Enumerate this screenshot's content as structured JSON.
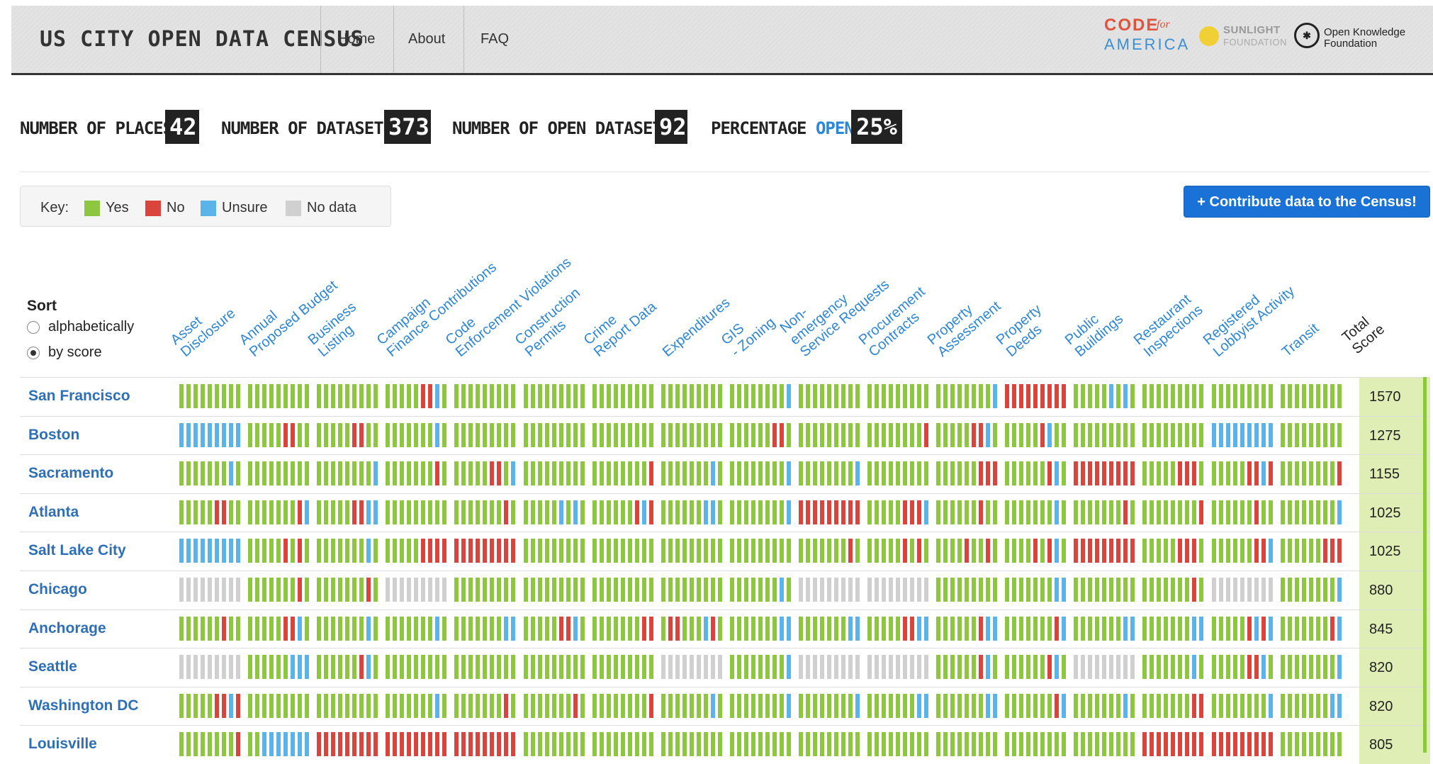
{
  "header": {
    "brand": "US CITY OPEN DATA CENSUS",
    "nav": [
      "Home",
      "About",
      "FAQ"
    ],
    "partners": {
      "cfa_top": "CODE",
      "cfa_for": "for",
      "cfa_bottom": "AMERICA",
      "sunlight_1": "SUNLIGHT",
      "sunlight_2": "FOUNDATION",
      "okf_1": "Open Knowledge",
      "okf_2": "Foundation"
    }
  },
  "stats": {
    "places_label": "NUMBER OF PLACES",
    "places_value": "42",
    "datasets_label": "NUMBER OF DATASETS",
    "datasets_value": "373",
    "open_label": "NUMBER OF OPEN DATASETS",
    "open_value": "92",
    "pct_label": "PERCENTAGE",
    "pct_open_word": "OPEN",
    "pct_value": "25%"
  },
  "key": {
    "label": "Key:",
    "items": [
      {
        "label": "Yes",
        "color": "#8dc63f"
      },
      {
        "label": "No",
        "color": "#d9453d"
      },
      {
        "label": "Unsure",
        "color": "#5ab4ea"
      },
      {
        "label": "No data",
        "color": "#d0d0d0"
      }
    ]
  },
  "cta": "+ Contribute data to the Census!",
  "sort": {
    "title": "Sort",
    "options": [
      {
        "label": "alphabetically",
        "selected": false
      },
      {
        "label": "by score",
        "selected": true
      }
    ]
  },
  "columns": [
    [
      "Asset",
      "Disclosure"
    ],
    [
      "Annual",
      "Proposed Budget"
    ],
    [
      "Business",
      "Listing"
    ],
    [
      "Campaign",
      "Finance Contributions"
    ],
    [
      "Code",
      "Enforcement Violations"
    ],
    [
      "Construction",
      "Permits"
    ],
    [
      "Crime",
      "Report Data"
    ],
    [
      "Expenditures"
    ],
    [
      "GIS",
      "- Zoning"
    ],
    [
      "Non-",
      "emergency",
      "Service Requests"
    ],
    [
      "Procurement",
      "Contracts"
    ],
    [
      "Property",
      "Assessment"
    ],
    [
      "Property",
      "Deeds"
    ],
    [
      "Public",
      "Buildings"
    ],
    [
      "Restaurant",
      "Inspections"
    ],
    [
      "Registered",
      "Lobbyist Activity"
    ],
    [
      "Transit"
    ]
  ],
  "total_header": [
    "Total",
    "Score"
  ],
  "colors": {
    "Y": "#8dc63f",
    "N": "#d9453d",
    "U": "#5ab4ea",
    "D": "#d0d0d0"
  },
  "rows": [
    {
      "city": "San Francisco",
      "score": "1570",
      "cells": [
        "YYYYYYYYY",
        "YYYYYYYYY",
        "YYYYYYYYY",
        "YYYYYNNUY",
        "YYYYYYYYY",
        "YYYYYYYYY",
        "YYYYYYYYY",
        "YYYYYYYYY",
        "YYYYYYYYU",
        "YYYYYYYYY",
        "YYYYYYYYY",
        "YYYYYYYYU",
        "NNNNNNNNN",
        "YYYYYUYUY",
        "YYYYYYYYY",
        "YYYYYYYYY",
        "YYYYYYYYY"
      ]
    },
    {
      "city": "Boston",
      "score": "1275",
      "cells": [
        "UUUUUUUUU",
        "YYYYYNNYY",
        "YYYYYNNYY",
        "YYYYYYYUY",
        "YYYYYYYYY",
        "YYYYYYYYY",
        "YYYYYYYYY",
        "YYYYYYYYY",
        "YYYYYYNNY",
        "YYYYYYYYY",
        "YYYYYYYYN",
        "YYYYYNNUY",
        "YYYYYNUYY",
        "YYYYYYYYY",
        "YYYYYYYYY",
        "UUUUUUUUU",
        "YYYYYYYYY"
      ]
    },
    {
      "city": "Sacramento",
      "score": "1155",
      "cells": [
        "YYYYYYYUY",
        "YYYYYYYYY",
        "YYYYYYYYU",
        "YYYYYYYNY",
        "YYYYYNNYU",
        "YYYYYYYYY",
        "YYYYYYYYN",
        "YYYYYYYUY",
        "YYYYYYYYU",
        "YYYYYYYYU",
        "YYYYYYYYY",
        "YYYYYYNNN",
        "YYYYYYNUY",
        "NNNNNNNNN",
        "YYYYYNNNY",
        "YYYYYNNUN",
        "YYYYYYYYN"
      ]
    },
    {
      "city": "Atlanta",
      "score": "1025",
      "cells": [
        "YYYYYNNYY",
        "YYYYYYYNU",
        "YYYYYNNUU",
        "YYYYYYYYY",
        "YYYYYYYNY",
        "YYYYYUYUY",
        "YYYYYYNUN",
        "YYYYYYUUY",
        "YYYYYYYYU",
        "NNNNNNNNN",
        "YYYYYNNNU",
        "YYYYYYNYY",
        "YYYYYYYUY",
        "YYYYYYYNY",
        "YYYYYYYYN",
        "YYYYYYNYY",
        "YYYYYYYYU"
      ]
    },
    {
      "city": "Salt Lake City",
      "score": "1025",
      "cells": [
        "UUUUUUUUU",
        "YYYYYNYNY",
        "YYYYYYYUY",
        "YYYYYNNNN",
        "NNNNNNNNN",
        "YYYYYYYYY",
        "YYYYYYYYY",
        "YYYYYYYYY",
        "YYYYYYYYY",
        "YYYYYYYNY",
        "YYYYYNYNY",
        "YYYYNYYNY",
        "YYYYNYNUY",
        "NNNNNNNNN",
        "YYYYYNNNY",
        "YYYYYYNNU",
        "YYYYYYNNN"
      ]
    },
    {
      "city": "Chicago",
      "score": "880",
      "cells": [
        "DDDDDDDDD",
        "YYYYYYYNY",
        "YYYYYYYNY",
        "DDDDDDDDD",
        "YYYYYYYYY",
        "YYYYYYYYY",
        "YYYYYYYYY",
        "YYYYYYYYY",
        "YYYYYYYUY",
        "DDDDDDDDD",
        "DDDDDDDDD",
        "YYYYYYYYY",
        "YYYYYYYUU",
        "YYYYYYYYY",
        "YYYYYYYNY",
        "DDDDDDDDD",
        "YYYYYYYYU"
      ]
    },
    {
      "city": "Anchorage",
      "score": "845",
      "cells": [
        "YYYYYYNYY",
        "YYYYYNNUY",
        "YYYYYYYUY",
        "YYYYYYYUY",
        "YYYYYYYUU",
        "YYYYYNNUY",
        "YYYYYYYNN",
        "YNNYYYUNY",
        "YYYYYYYUU",
        "YYYYYYYUU",
        "YYYYYNNUU",
        "YYYYYYNUU",
        "YYYYYYYNU",
        "YYYYYYYUU",
        "YYYYYYYUU",
        "YYYYYNUNU",
        "YYYYYYYNU"
      ]
    },
    {
      "city": "Seattle",
      "score": "820",
      "cells": [
        "DDDDDDDDD",
        "YYYYYYUUU",
        "YYYYYYNUY",
        "YYYYYYYYY",
        "YYYYYYYYY",
        "YYYYYYYYY",
        "YYYYYYYYY",
        "DDDDDDDDD",
        "YYYYYYYYU",
        "DDDDDDDDD",
        "DDDDDDDDD",
        "YYYYYYNUY",
        "YYYYYYNUY",
        "DDDDDDDDD",
        "YYYYYYYUY",
        "YYYYYNNUY",
        "YYYYYYYYU"
      ]
    },
    {
      "city": "Washington DC",
      "score": "820",
      "cells": [
        "YYYYYNNUN",
        "YYYYYYYYY",
        "YYYYYYYYY",
        "YYYYYYYUY",
        "YYYYYYYNY",
        "YYYYYYYNY",
        "YYYYYYYYN",
        "YYYYYYYUY",
        "YYYYYYYYU",
        "YYYYYYYYU",
        "YYYYYYYUU",
        "YYYYYYYUU",
        "YYYYYYYNU",
        "YYYYYYYUY",
        "YYYYYYYNN",
        "YYYYYYYYU",
        "YYYYYYYUU"
      ]
    },
    {
      "city": "Louisville",
      "score": "805",
      "cells": [
        "YYYYYYYYN",
        "YYUUUUUUU",
        "NNNNNNNNN",
        "NNNNNNNNN",
        "NNNNNNNNN",
        "YYYYYYYYY",
        "YYYYYYYYY",
        "YYYYYYYYY",
        "YYYYYYYYY",
        "YYYYYYYYY",
        "YYYYYYYYY",
        "YYYYYYYYY",
        "YYYYYYYYY",
        "YYYYYYYYY",
        "NNNNNNNNN",
        "NNNNNNNNN",
        "YYYYYYYYY"
      ]
    }
  ]
}
